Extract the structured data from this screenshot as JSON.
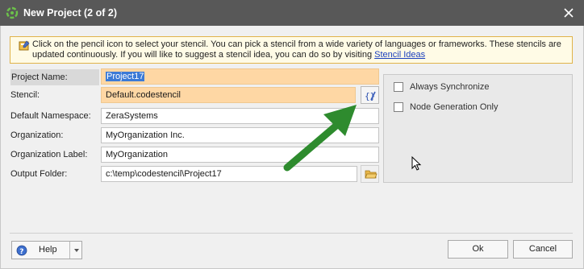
{
  "window": {
    "title": "New Project (2 of 2)"
  },
  "info": {
    "text": "Click on the pencil icon to select your stencil. You can pick a stencil from a wide variety of languages or frameworks. These stencils are updated continuously. If you will like to suggest a stencil idea, you can do so by visiting ",
    "link": "Stencil Ideas"
  },
  "form": {
    "project_name_label": "Project Name:",
    "project_name_value": "Project17",
    "stencil_label": "Stencil:",
    "stencil_value": "Default.codestencil",
    "namespace_label": "Default Namespace:",
    "namespace_value": "ZeraSystems",
    "organization_label": "Organization:",
    "organization_value": "MyOrganization Inc.",
    "org_label_label": "Organization Label:",
    "org_label_value": "MyOrganization",
    "output_folder_label": "Output Folder:",
    "output_folder_value": "c:\\temp\\codestencil\\Project17"
  },
  "options": {
    "always_sync": "Always Synchronize",
    "node_gen_only": "Node Generation Only"
  },
  "footer": {
    "help": "Help",
    "ok": "Ok",
    "cancel": "Cancel"
  },
  "icons": [
    "app-icon",
    "close-icon",
    "info-icon",
    "stencil-picker-icon",
    "folder-icon",
    "help-icon",
    "chevron-down-icon"
  ],
  "colors": {
    "titlebar": "#585858",
    "highlight_field": "#fed7a4",
    "selection": "#3b7ad6",
    "annotation_arrow": "#2e8b2e"
  }
}
